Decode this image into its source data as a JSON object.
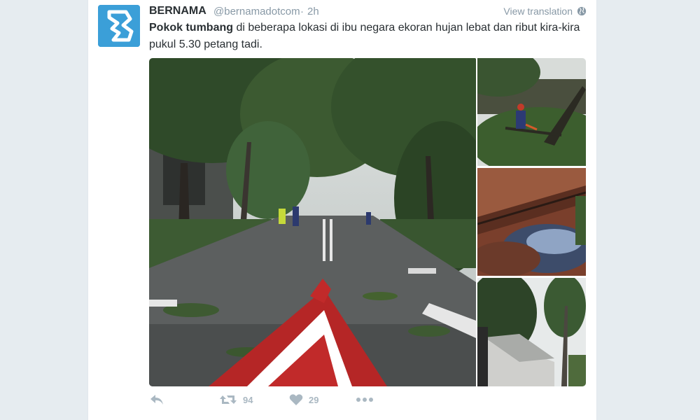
{
  "tweet": {
    "display_name": "BERNAMA",
    "handle": "@bernamadotcom",
    "separator": "·",
    "time": "2h",
    "view_translation": "View translation",
    "text_bold": "Pokok tumbang",
    "text_rest": " di beberapa lokasi di ibu negara ekoran hujan lebat dan ribut kira-kira pukul 5.30 petang tadi.",
    "retweet_count": "94",
    "like_count": "29"
  },
  "icons": {
    "reply": "reply-icon",
    "retweet": "retweet-icon",
    "like": "heart-icon",
    "more": "more-icon",
    "translate": "globe-icon"
  },
  "colors": {
    "avatar_bg": "#3b9fd8",
    "secondary_text": "#8899a6",
    "action_gray": "#aab8c2",
    "page_bg": "#e6ecf0"
  }
}
